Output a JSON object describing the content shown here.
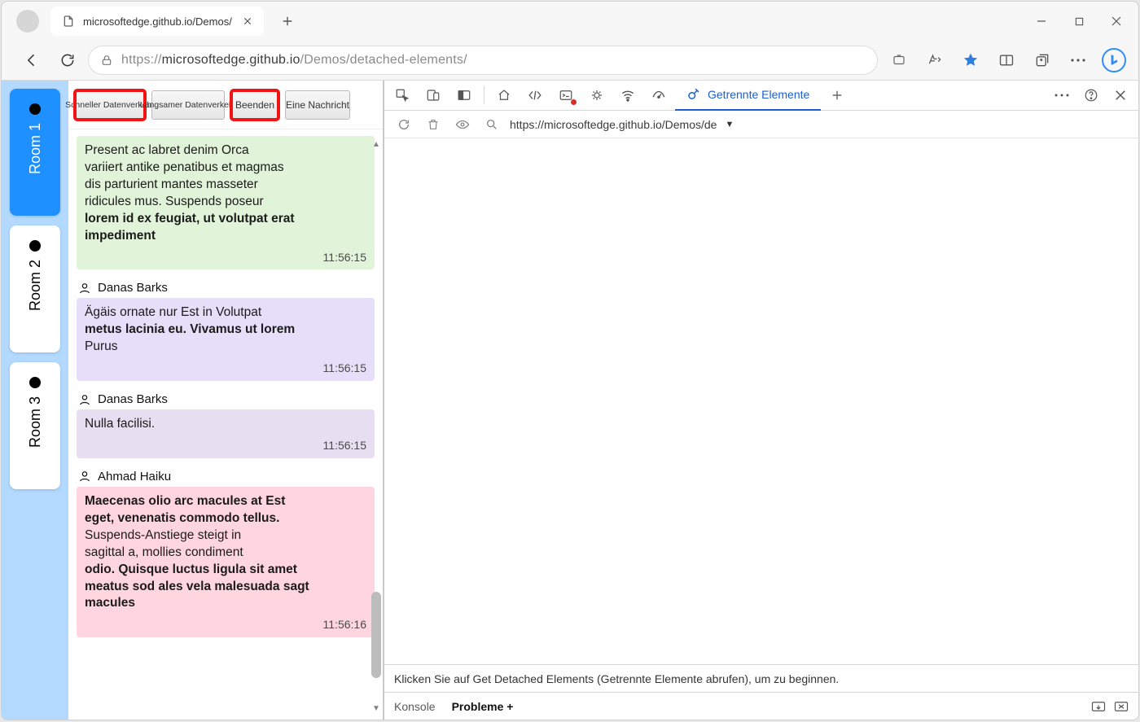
{
  "browser": {
    "tab_title": "microsoftedge.github.io/Demos/",
    "url_proto": "https://",
    "url_host": "microsoftedge.github.io",
    "url_path": "/Demos/detached-elements/"
  },
  "rooms": [
    {
      "label": "Room 1",
      "active": true
    },
    {
      "label": "Room 2",
      "active": false
    },
    {
      "label": "Room 3",
      "active": false
    }
  ],
  "toolbar": {
    "fast": "Schneller Datenverkehr",
    "slow": "Langsamer Datenverkehr",
    "stop": "Beenden",
    "one": "Eine Nachricht"
  },
  "messages": [
    {
      "from": "",
      "color": "green",
      "lines": [
        "Present ac labret denim          Orca",
        "variiert antike penatibus et magmas",
        "dis parturient mantes masseter",
        "ridicules mus. Suspends poseur",
        "lorem id ex feugiat, ut volutpat erat",
        "impediment"
      ],
      "ts": "11:56:15"
    },
    {
      "from": "Danas   Barks",
      "color": "purple",
      "lines": [
        "Ägäis ornate nur Est in Volutpat",
        "metus lacinia eu. Vivamus ut lorem",
        "Purus"
      ],
      "ts": "11:56:15"
    },
    {
      "from": "Danas Barks",
      "color": "purple2",
      "lines": [
        "Nulla facilisi."
      ],
      "ts": "11:56:15"
    },
    {
      "from": "Ahmad   Haiku",
      "color": "pink",
      "lines": [
        "Maecenas olio arc macules at Est",
        "eget, venenatis commodo tellus.",
        "Suspends-Anstiege steigt in",
        "sagittal a, mollies condiment",
        "odio. Quisque luctus ligula sit amet",
        "meatus sod ales vela malesuada sagt",
        "macules"
      ],
      "ts": "11:56:16"
    }
  ],
  "devtools": {
    "active_tab": "Getrennte Elemente",
    "path": "https://microsoftedge.github.io/Demos/de",
    "hint": "Klicken Sie auf Get Detached Elements (Getrennte Elemente abrufen), um zu beginnen.",
    "drawer": {
      "konsole": "Konsole",
      "probleme": "Probleme +"
    }
  }
}
